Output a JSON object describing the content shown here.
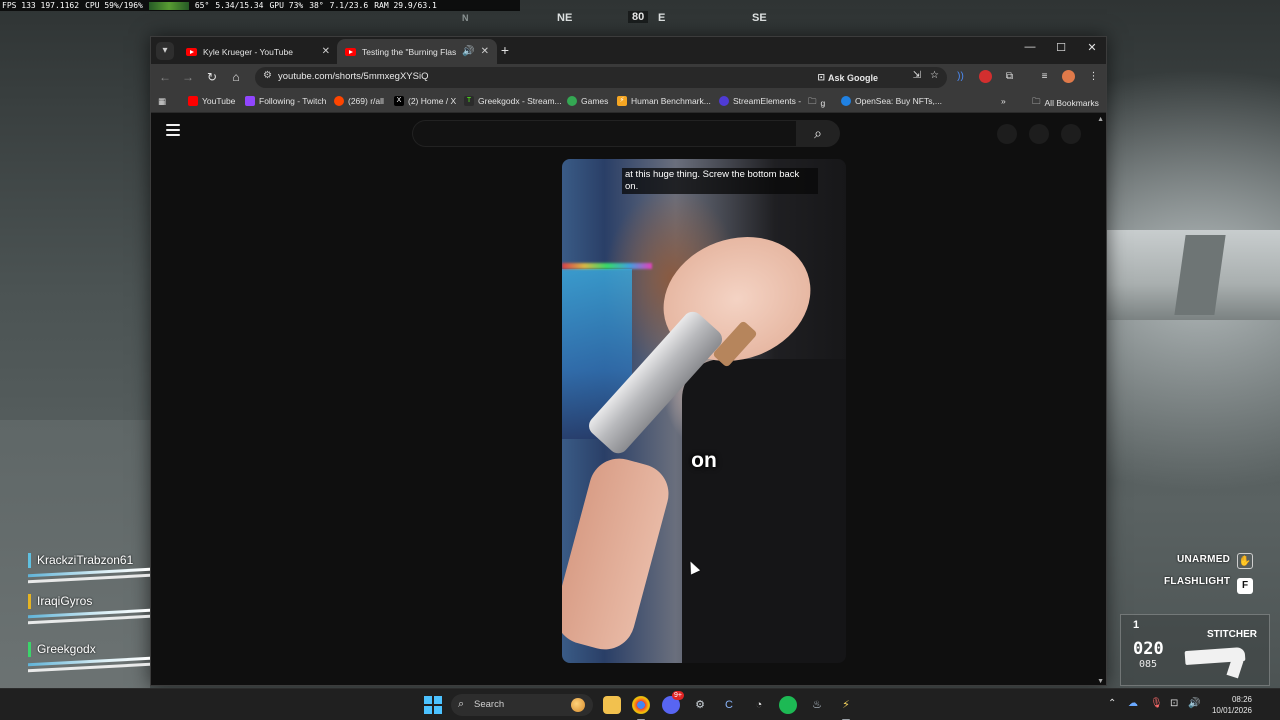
{
  "perf": {
    "fps": "FPS 133 197.1162",
    "cpu": "CPU 59%/196%",
    "temp": "65°",
    "mem": "5.34/15.34",
    "gpu": "GPU 73%",
    "gpu_temp": "38°",
    "vram": "7.1/23.6",
    "ram": "RAM 29.9/63.1"
  },
  "compass": {
    "north": "N",
    "northeast": "NE",
    "heading": "80",
    "east": "E",
    "southeast": "SE"
  },
  "browser": {
    "tabs": [
      {
        "title": "Kyle Krueger - YouTube",
        "close": "✕"
      },
      {
        "title": "Testing the \"Burning Flashli",
        "audio": "🔊",
        "close": "✕"
      }
    ],
    "new_tab": "+",
    "window_controls": {
      "minimize": "—",
      "maximize": "☐",
      "close": "✕"
    },
    "toolbar": {
      "back": "←",
      "forward": "→",
      "reload": "↻",
      "home": "⌂",
      "url": "youtube.com/shorts/5mmxegXYSiQ",
      "ask_google": "Ask Google"
    },
    "bookmarks": [
      {
        "label": "YouTube",
        "color": "#ff0000"
      },
      {
        "label": "Following - Twitch",
        "color": "#9146ff"
      },
      {
        "label": "(269) r/all",
        "color": "#ff4500"
      },
      {
        "label": "(2) Home / X",
        "color": "#000000"
      },
      {
        "label": "Greekgodx - Stream...",
        "color": "#53fc18"
      },
      {
        "label": "Games",
        "color": "#34a853"
      },
      {
        "label": "Human Benchmark...",
        "color": "#f5a623"
      },
      {
        "label": "StreamElements -",
        "color": "#4f3bd4"
      },
      {
        "label": "g",
        "color": "#aaaaaa"
      },
      {
        "label": "OpenSea: Buy NFTs,...",
        "color": "#2081e2"
      }
    ],
    "bookmarks_overflow": "»",
    "all_bookmarks": "All Bookmarks"
  },
  "youtube": {
    "caption_top": "at this huge thing. Screw the bottom back on.",
    "caption_word": "on"
  },
  "hud": {
    "squad": [
      {
        "name": "KrackziTrabzon61",
        "color": "#5fc0e0"
      },
      {
        "name": "IraqiGyros",
        "color": "#e6b422"
      },
      {
        "name": "Greekgodx",
        "color": "#3bd46a"
      }
    ],
    "unarmed_label": "UNARMED",
    "flashlight_label": "FLASHLIGHT",
    "flashlight_key": "F",
    "weapon": {
      "slot": "1",
      "name": "STITCHER",
      "ammo": "020",
      "reserve": "085"
    }
  },
  "taskbar": {
    "search_label": "Search",
    "time": "08:26",
    "date": "10/01/2026",
    "discord_badge": "9+"
  }
}
